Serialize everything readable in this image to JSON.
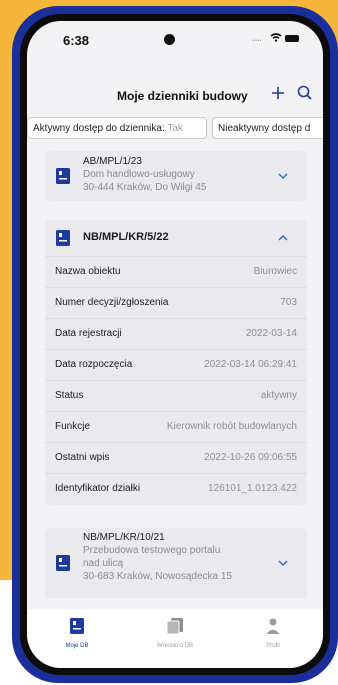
{
  "status_bar": {
    "time": "6:38",
    "signal": "...."
  },
  "header": {
    "title": "Moje dzienniki budowy",
    "add_icon": "plus-icon",
    "search_icon": "search-icon"
  },
  "filters": {
    "active": {
      "label": "Aktywny dostęp do dziennika:",
      "value": "Tak"
    },
    "inactive": {
      "label": "Nieaktywny dostęp d"
    }
  },
  "cards": [
    {
      "number": "AB/MPL/1/23",
      "name": "Dom handlowo-usługowy",
      "address": "30-444 Kraków, Do Wilgi 45"
    },
    {
      "number": "NB/MPL/KR/5/22",
      "details": [
        {
          "label": "Nazwa obiektu",
          "value": "Biurowiec"
        },
        {
          "label": "Numer decyzji/zgłoszenia",
          "value": "703"
        },
        {
          "label": "Data rejestracji",
          "value": "2022-03-14"
        },
        {
          "label": "Data rozpoczęcia",
          "value": "2022-03-14 06:29:41"
        },
        {
          "label": "Status",
          "value": "aktywny"
        },
        {
          "label": "Funkcje",
          "value": "Kierownik robót budowlanych"
        },
        {
          "label": "Ostatni wpis",
          "value": "2022-10-26 09:06:55"
        },
        {
          "label": "Identyfikator działki",
          "value": "126101_1.0123.422"
        }
      ]
    },
    {
      "number": "NB/MPL/KR/10/21",
      "name_line1": "Przebudowa testowego portalu",
      "name_line2": "nad ulicą",
      "address": "30-683 Kraków, Nowosądecka 15"
    }
  ],
  "tabbar": [
    {
      "label": "Moje DB",
      "icon": "journal-icon",
      "active": true
    },
    {
      "label": "Wnioski o DB",
      "icon": "documents-icon",
      "active": false
    },
    {
      "label": "Profil",
      "icon": "person-icon",
      "active": false
    }
  ],
  "colors": {
    "accent": "#1e3a9e",
    "frame": "#1a2f9a",
    "background": "#f6b63c",
    "chevron": "#2f6fd6"
  }
}
